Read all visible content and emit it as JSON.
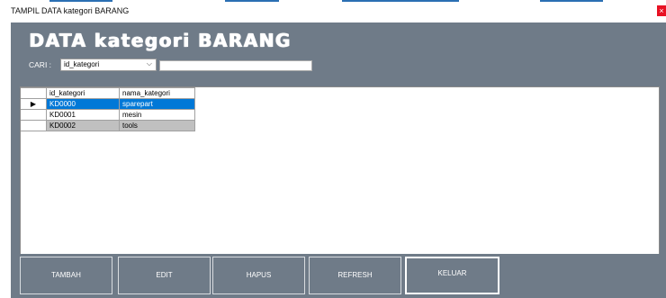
{
  "window": {
    "title": "TAMPIL DATA  kategori BARANG",
    "close_glyph": "×"
  },
  "heading": "DATA  kategori BARANG",
  "search": {
    "label": "CARI :",
    "field_selected": "id_kategori",
    "dropdown_glyph": "⌵",
    "query": ""
  },
  "grid": {
    "columns": [
      "id_kategori",
      "nama_kategori"
    ],
    "current_row_marker": "▶",
    "rows": [
      {
        "id_kategori": "KD0000",
        "nama_kategori": "sparepart"
      },
      {
        "id_kategori": "KD0001",
        "nama_kategori": "mesin"
      },
      {
        "id_kategori": "KD0002",
        "nama_kategori": "tools"
      }
    ]
  },
  "buttons": {
    "tambah": "TAMBAH",
    "edit": "EDIT",
    "hapus": "HAPUS",
    "refresh": "REFRESH",
    "keluar": "KELUAR"
  },
  "colors": {
    "background": "#6f7b88",
    "selection": "#0078d7",
    "alt_row": "#c0c0c0",
    "close": "#e81123"
  }
}
